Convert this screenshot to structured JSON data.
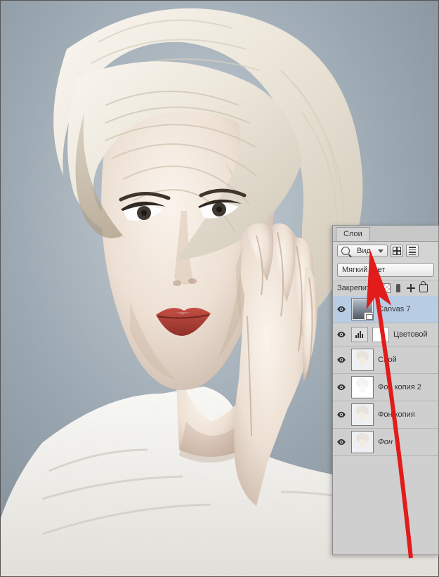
{
  "panel": {
    "tab_label": "Слои",
    "filter_label": "Вид",
    "blend_mode": "Мягкий свет",
    "lock_label": "Закрепить:"
  },
  "layers": [
    {
      "name": "Canvas 7",
      "selected": true,
      "has_badge": true,
      "thumb": "dark",
      "italic": false
    },
    {
      "name": "Цветовой",
      "fx_row": true
    },
    {
      "name": "Слой",
      "thumb": "portrait",
      "italic": false
    },
    {
      "name": "Фон копия 2",
      "thumb": "sketch",
      "italic": false
    },
    {
      "name": "Фон копия",
      "thumb": "portrait",
      "italic": false
    },
    {
      "name": "Фон",
      "thumb": "portrait",
      "italic": true
    }
  ]
}
